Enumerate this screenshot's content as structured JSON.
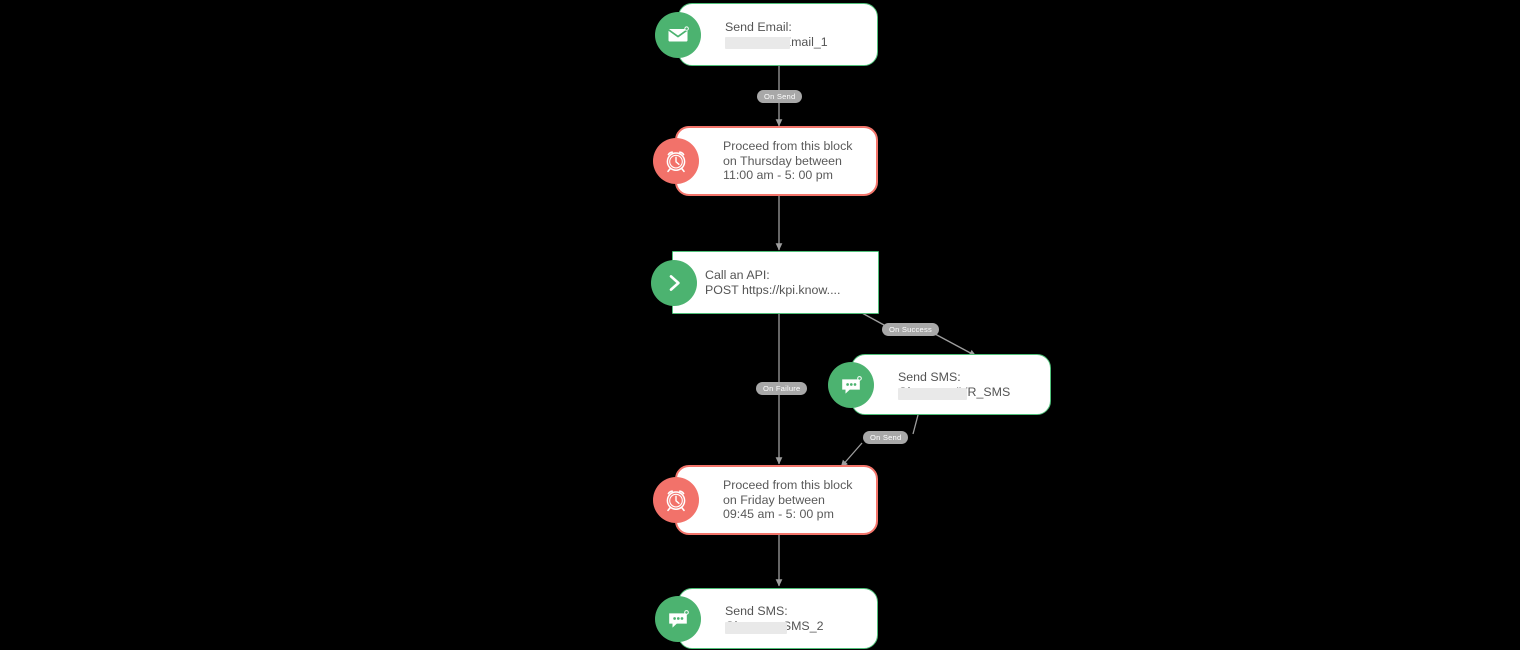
{
  "diagram": {
    "type": "workflow-flowchart",
    "background_color": "#000000",
    "colors": {
      "green_accent": "#4cb370",
      "green_border": "#4fbf79",
      "red_accent": "#f2726a",
      "red_border": "#f3756b",
      "edge_line": "#9e9e9e",
      "pill_background": "#a8a8a8",
      "pill_text": "#ffffff",
      "node_text": "#545454",
      "node_background": "#ffffff",
      "redaction": "#e9e9e9"
    }
  },
  "nodes": [
    {
      "id": "send-email-1",
      "kind": "send-email",
      "icon": "envelope-icon",
      "icon_color": "green",
      "title": "Send Email:",
      "subtitle": "Gigamart_Email_1",
      "subtitle_visible_suffix": "Email_1",
      "redacted": true
    },
    {
      "id": "delay-thursday",
      "kind": "time-delay",
      "icon": "alarm-clock-icon",
      "icon_color": "red",
      "line1": "Proceed from this block",
      "line2": "on Thursday between",
      "line3": "11:00 am - 5: 00 pm",
      "redacted": false
    },
    {
      "id": "call-api",
      "kind": "call-api",
      "icon": "chevron-right-icon",
      "icon_color": "green",
      "title": "Call an API:",
      "subtitle": "POST https://kpi.know....",
      "redacted": false
    },
    {
      "id": "send-sms-ivr",
      "kind": "send-sms",
      "icon": "message-bubble-icon",
      "icon_color": "green",
      "title": "Send SMS:",
      "subtitle": "Gigamart_IVR_SMS",
      "subtitle_visible_suffix": "_IVR_SMS",
      "redacted": true
    },
    {
      "id": "delay-friday",
      "kind": "time-delay",
      "icon": "alarm-clock-icon",
      "icon_color": "red",
      "line1": "Proceed from this block",
      "line2": "on Friday between",
      "line3": "09:45 am - 5: 00 pm",
      "redacted": false
    },
    {
      "id": "send-sms-2",
      "kind": "send-sms",
      "icon": "message-bubble-icon",
      "icon_color": "green",
      "title": "Send SMS:",
      "subtitle": "Gigamart_SMS_2",
      "subtitle_visible_suffix": "_SMS_2",
      "redacted": true
    }
  ],
  "edges": [
    {
      "id": "e1",
      "from": "send-email-1",
      "to": "delay-thursday",
      "label": "On Send"
    },
    {
      "id": "e2",
      "from": "delay-thursday",
      "to": "call-api",
      "label": ""
    },
    {
      "id": "e3",
      "from": "call-api",
      "to": "send-sms-ivr",
      "label": "On Success"
    },
    {
      "id": "e4",
      "from": "call-api",
      "to": "delay-friday",
      "label": "On Failure"
    },
    {
      "id": "e5",
      "from": "send-sms-ivr",
      "to": "delay-friday",
      "label": "On Send"
    },
    {
      "id": "e6",
      "from": "delay-friday",
      "to": "send-sms-2",
      "label": ""
    }
  ]
}
